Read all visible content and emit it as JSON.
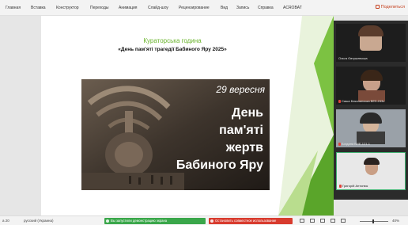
{
  "ribbon": {
    "tabs": [
      "Главная",
      "Вставка",
      "Конструктор",
      "Переходы",
      "Анимация",
      "Слайд-шоу",
      "Рецензирование",
      "Вид",
      "Запись",
      "Справка",
      "ACROBAT"
    ],
    "share_label": "Поделиться"
  },
  "slide": {
    "title": "Кураторська година",
    "subtitle": "«День пам'яті трагедії Бабиного Яру 2025»",
    "image": {
      "date": "29 вересня",
      "caption_lines": [
        "День",
        "пам'яті",
        "жертв",
        "Бабиного Яру"
      ]
    },
    "accent_color": "#6ab42c"
  },
  "participants": [
    {
      "name": "Ольга Євтушевська",
      "muted": false
    },
    {
      "name": "Саша Бекалинська ВЕЗ-243с",
      "muted": true
    },
    {
      "name": "Богдана ВИЕ-121-1",
      "muted": true
    },
    {
      "name": "Григорій Антонюк",
      "muted": true
    }
  ],
  "statusbar": {
    "slide_info": "а 20",
    "language": "русский (Украина)",
    "share_screen_label": "Вы запустили демонстрацию экрана",
    "stop_share_label": "Остановить совместное использование",
    "zoom": "40%"
  }
}
